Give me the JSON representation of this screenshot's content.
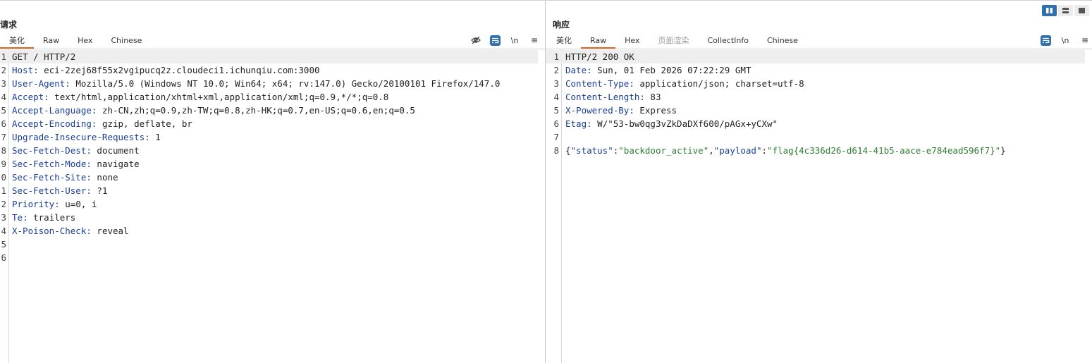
{
  "request": {
    "title": "请求",
    "tabs": [
      "美化",
      "Raw",
      "Hex",
      "Chinese"
    ],
    "active_tab": 0,
    "tools": {
      "wrap_icon": "wrap-icon",
      "newline_label": "\\n",
      "menu_glyph": "≡"
    },
    "lines": [
      {
        "n": "1",
        "text": "GET / HTTP/2"
      },
      {
        "n": "2",
        "key": "Host",
        "val": " eci-2zej68f55x2vgipucq2z.cloudeci1.ichunqiu.com:3000"
      },
      {
        "n": "3",
        "key": "User-Agent",
        "val": " Mozilla/5.0 (Windows NT 10.0; Win64; x64; rv:147.0) Gecko/20100101 Firefox/147.0"
      },
      {
        "n": "4",
        "key": "Accept",
        "val": " text/html,application/xhtml+xml,application/xml;q=0.9,*/*;q=0.8"
      },
      {
        "n": "5",
        "key": "Accept-Language",
        "val": " zh-CN,zh;q=0.9,zh-TW;q=0.8,zh-HK;q=0.7,en-US;q=0.6,en;q=0.5"
      },
      {
        "n": "6",
        "key": "Accept-Encoding",
        "val": " gzip, deflate, br"
      },
      {
        "n": "7",
        "key": "Upgrade-Insecure-Requests",
        "val": " 1"
      },
      {
        "n": "8",
        "key": "Sec-Fetch-Dest",
        "val": " document"
      },
      {
        "n": "9",
        "key": "Sec-Fetch-Mode",
        "val": " navigate"
      },
      {
        "n": "0",
        "key": "Sec-Fetch-Site",
        "val": " none"
      },
      {
        "n": "1",
        "key": "Sec-Fetch-User",
        "val": " ?1"
      },
      {
        "n": "2",
        "key": "Priority",
        "val": " u=0, i"
      },
      {
        "n": "3",
        "key": "Te",
        "val": " trailers"
      },
      {
        "n": "4",
        "key": "X-Poison-Check",
        "val": " reveal"
      },
      {
        "n": "5",
        "text": ""
      },
      {
        "n": "6",
        "text": ""
      }
    ]
  },
  "response": {
    "title": "响应",
    "tabs": [
      "美化",
      "Raw",
      "Hex",
      "页面渲染",
      "CollectInfo",
      "Chinese"
    ],
    "active_tab": 1,
    "tools": {
      "wrap_icon": "wrap-icon",
      "newline_label": "\\n",
      "menu_glyph": "≡"
    },
    "lines": [
      {
        "n": "1",
        "text": "HTTP/2 200 OK"
      },
      {
        "n": "2",
        "key": "Date",
        "val": " Sun, 01 Feb 2026 07:22:29 GMT"
      },
      {
        "n": "3",
        "key": "Content-Type",
        "val": " application/json; charset=utf-8"
      },
      {
        "n": "4",
        "key": "Content-Length",
        "val": " 83"
      },
      {
        "n": "5",
        "key": "X-Powered-By",
        "val": " Express"
      },
      {
        "n": "6",
        "key": "Etag",
        "val": " W/\"53-bw0qg3vZkDaDXf600/pAGx+yCXw\""
      },
      {
        "n": "7",
        "text": ""
      },
      {
        "n": "8",
        "json": [
          [
            "jpun",
            "{"
          ],
          [
            "jkey",
            "\"status\""
          ],
          [
            "jpun",
            ":"
          ],
          [
            "jstr",
            "\"backdoor_active\""
          ],
          [
            "jpun",
            ","
          ],
          [
            "jkey",
            "\"payload\""
          ],
          [
            "jpun",
            ":"
          ],
          [
            "jstr",
            "\"flag{4c336d26-d614-41b5-aace-e784ead596f7}\""
          ],
          [
            "jpun",
            "}"
          ]
        ]
      }
    ]
  },
  "layout_buttons": [
    "split-horizontal-icon",
    "split-vertical-icon",
    "single-pane-icon"
  ]
}
